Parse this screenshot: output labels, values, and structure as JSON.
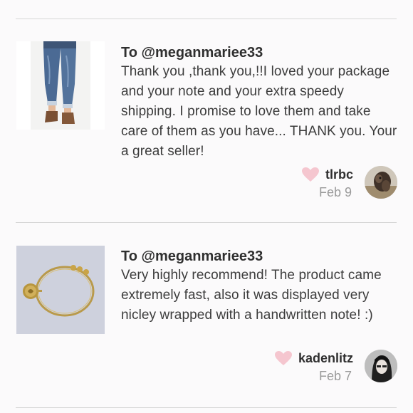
{
  "reviews": [
    {
      "recipient": "To @meganmariee33",
      "text": "Thank you ,thank you,!!I loved your package and your note and your extra speedy shipping. I promise to love them and take care of them as you have... THANK you. Your a great seller!",
      "username": "tlrbc",
      "date": "Feb 9",
      "thumbnail_icon": "jeans-photo",
      "avatar_icon": "dog-avatar"
    },
    {
      "recipient": "To @meganmariee33",
      "text": "Very highly recommend! The product came extremely fast, also it was displayed very nicley wrapped with a handwritten note! :)",
      "username": "kadenlitz",
      "date": "Feb 7",
      "thumbnail_icon": "bracelet-photo",
      "avatar_icon": "person-avatar"
    }
  ],
  "colors": {
    "heart": "#f5c6cf",
    "divider": "#d6d6d6",
    "date": "#9a9a9a"
  }
}
